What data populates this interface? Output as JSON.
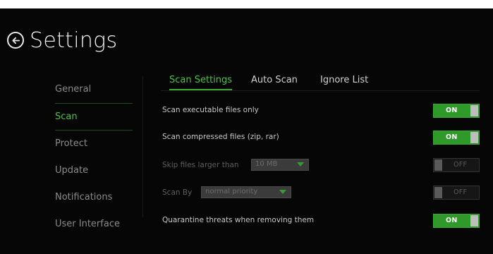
{
  "header": {
    "title": "Settings",
    "back_icon": "circle-arrow-left-icon"
  },
  "sidebar": {
    "items": [
      {
        "label": "General",
        "active": false
      },
      {
        "label": "Scan",
        "active": true
      },
      {
        "label": "Protect",
        "active": false
      },
      {
        "label": "Update",
        "active": false
      },
      {
        "label": "Notifications",
        "active": false
      },
      {
        "label": "User Interface",
        "active": false
      }
    ]
  },
  "tabs": [
    {
      "label": "Scan Settings",
      "active": true
    },
    {
      "label": "Auto Scan",
      "active": false
    },
    {
      "label": "Ignore List",
      "active": false
    }
  ],
  "settings": [
    {
      "label": "Scan executable files only",
      "toggle": "ON",
      "enabled": true
    },
    {
      "label": "Scan compressed files (zip, rar)",
      "toggle": "ON",
      "enabled": true
    },
    {
      "label": "Skip files larger than",
      "dropdown_value": "10 MB",
      "toggle": "OFF",
      "enabled": false
    },
    {
      "label": "Scan By",
      "dropdown_value": "normal priority",
      "toggle": "OFF",
      "enabled": false
    },
    {
      "label": "Quarantine threats when removing them",
      "toggle": "ON",
      "enabled": true
    }
  ],
  "colors": {
    "accent": "#4fc247",
    "toggle_on": "#2f9a2a",
    "background": "#060606"
  }
}
